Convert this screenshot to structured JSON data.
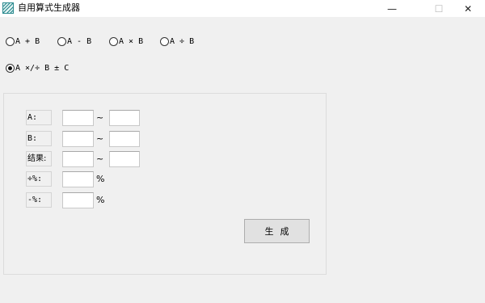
{
  "window": {
    "title": "自用算式生成器",
    "icon": "app-icon",
    "controls": {
      "minimize": "—",
      "maximize": "☐",
      "close": "✕"
    }
  },
  "operations": [
    {
      "label": "A + B",
      "checked": false
    },
    {
      "label": "A - B",
      "checked": false
    },
    {
      "label": "A × B",
      "checked": false
    },
    {
      "label": "A ÷ B",
      "checked": false
    },
    {
      "label": "A ×/÷ B ± C",
      "checked": true
    }
  ],
  "form": {
    "a_label": "A:",
    "b_label": "B:",
    "result_label": "结果:",
    "div_label": "÷%:",
    "minus_label": "-%:",
    "range_sep": "~",
    "percent": "%",
    "a_min": "",
    "a_max": "",
    "b_min": "",
    "b_max": "",
    "result_min": "",
    "result_max": "",
    "div_percent": "",
    "minus_percent": ""
  },
  "generate_label": "生成"
}
